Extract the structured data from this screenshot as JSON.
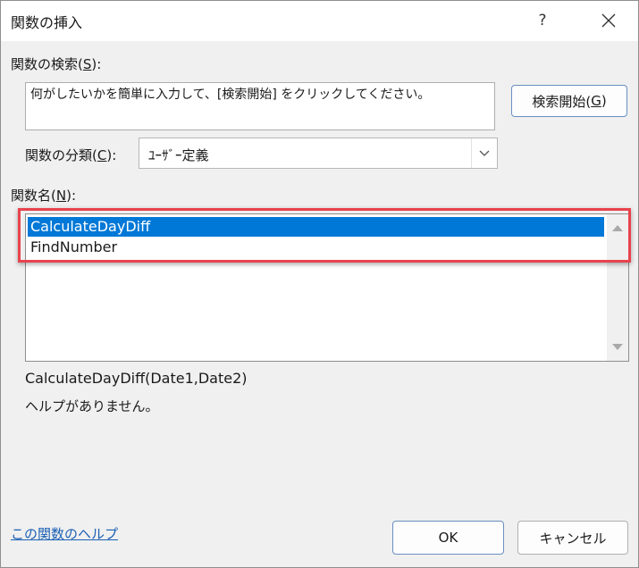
{
  "dialog": {
    "title": "関数の挿入",
    "help_button": "?"
  },
  "search": {
    "label_pre": "関数の検索(",
    "label_key": "S",
    "label_post": "):",
    "text": "何がしたいかを簡単に入力して、[検索開始] をクリックしてください。",
    "button_pre": "検索開始(",
    "button_key": "G",
    "button_post": ")"
  },
  "category": {
    "label_pre": "関数の分類(",
    "label_key": "C",
    "label_post": "):",
    "selected": "ﾕｰｻﾞｰ定義"
  },
  "functions": {
    "label_pre": "関数名(",
    "label_key": "N",
    "label_post": "):",
    "items": [
      {
        "label": "CalculateDayDiff",
        "selected": true
      },
      {
        "label": "FindNumber",
        "selected": false
      }
    ]
  },
  "details": {
    "signature": "CalculateDayDiff(Date1,Date2)",
    "description": "ヘルプがありません。"
  },
  "footer": {
    "help_link": "この関数のヘルプ",
    "ok": "OK",
    "cancel": "キャンセル"
  },
  "colors": {
    "selection": "#0078d7",
    "highlight_frame": "#e8434d",
    "link": "#1a5fb4"
  },
  "icons": [
    "close-icon",
    "chevron-down-icon",
    "scroll-up-icon",
    "scroll-down-icon"
  ]
}
